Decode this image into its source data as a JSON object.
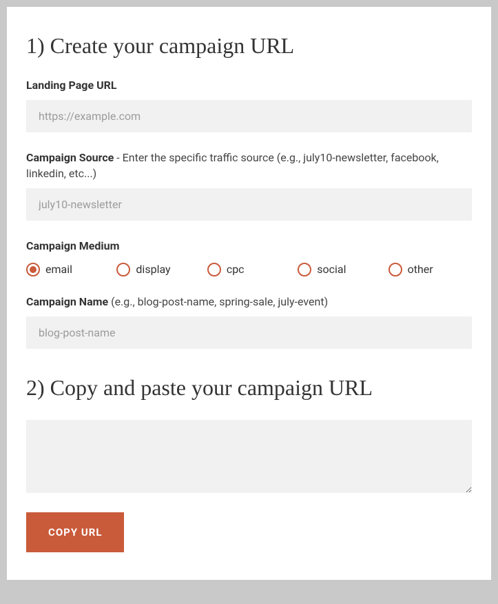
{
  "section1": {
    "heading": "1) Create your campaign URL",
    "landing": {
      "label": "Landing Page URL",
      "placeholder": "https://example.com",
      "value": ""
    },
    "source": {
      "label_bold": "Campaign Source",
      "label_rest": " - Enter the specific traffic source (e.g., july10-newsletter, facebook, linkedin, etc...)",
      "placeholder": "july10-newsletter",
      "value": ""
    },
    "medium": {
      "label": "Campaign Medium",
      "options": [
        "email",
        "display",
        "cpc",
        "social",
        "other"
      ],
      "selected": "email"
    },
    "name": {
      "label_bold": "Campaign Name",
      "label_rest": " (e.g., blog-post-name, spring-sale, july-event)",
      "placeholder": "blog-post-name",
      "value": ""
    }
  },
  "section2": {
    "heading": "2) Copy and paste your campaign URL",
    "output": "",
    "copy_button": "COPY URL"
  },
  "colors": {
    "accent": "#c95a3a"
  }
}
